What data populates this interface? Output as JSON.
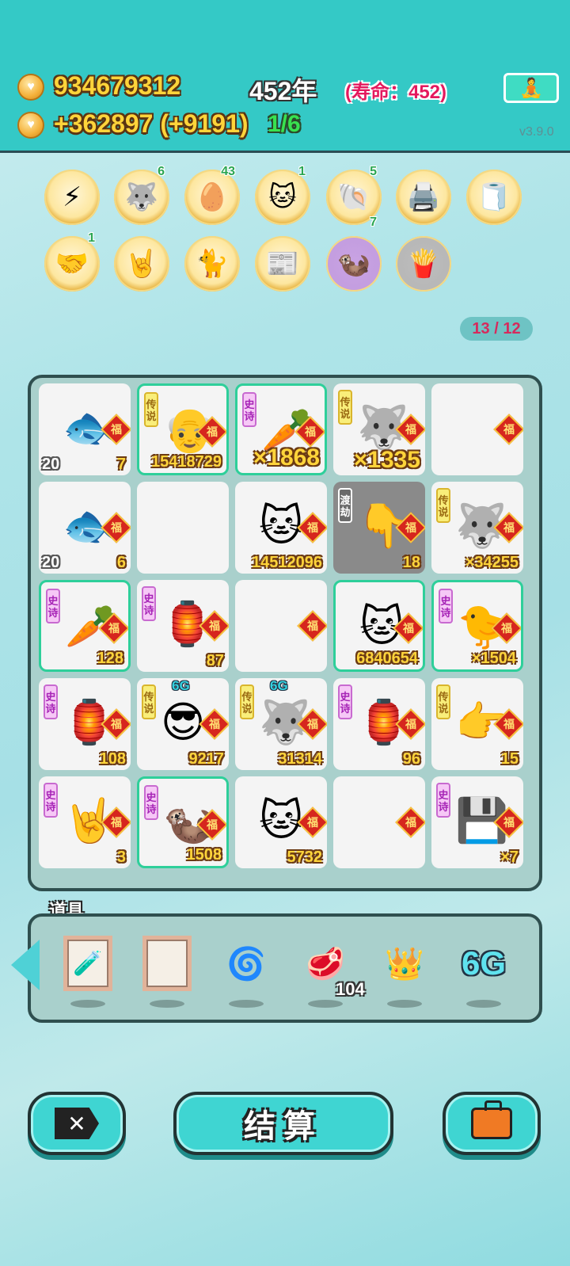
{
  "header": {
    "coins": "934679312",
    "income": "+362897 (+9191)",
    "year": "452年",
    "lifespan": "(寿命：452)",
    "fraction": "1/6",
    "version": "v3.9.0",
    "meditate_icon": "meditation-icon"
  },
  "buffs": [
    {
      "icon": "⚡",
      "name": "lightning-icon",
      "badge": ""
    },
    {
      "icon": "🐺",
      "name": "husky-icon",
      "badge": "6"
    },
    {
      "icon": "🥚",
      "name": "egg-tray-icon",
      "badge": "43"
    },
    {
      "icon": "🐱",
      "name": "cat-icon",
      "badge": "1"
    },
    {
      "icon": "🐚",
      "name": "shell-icon",
      "badge": "5",
      "badge2": "7"
    },
    {
      "icon": "🖨️",
      "name": "printer-icon",
      "badge": ""
    },
    {
      "icon": "🧻",
      "name": "tissue-box-icon",
      "badge": ""
    },
    {
      "icon": "🤝",
      "name": "handshake-icon",
      "badge": "1"
    },
    {
      "icon": "🤘",
      "name": "rock-hand-icon",
      "badge": ""
    },
    {
      "icon": "🐈",
      "name": "cats-icon",
      "badge": ""
    },
    {
      "icon": "📰",
      "name": "time-magazine-icon",
      "badge": ""
    },
    {
      "icon": "🦦",
      "name": "otters-icon",
      "badge": ""
    },
    {
      "icon": "🍟",
      "name": "fries-icon",
      "badge": ""
    }
  ],
  "progress_pill": "13 / 12",
  "fu_text": "福",
  "tags": {
    "legend": "传说",
    "epic": "史诗",
    "tribulation": "渡劫"
  },
  "grid": [
    [
      {
        "icon": "🐟",
        "left": "20",
        "right": "7"
      },
      {
        "icon": "👴",
        "tag": "legend",
        "right": "15418729",
        "green": true
      },
      {
        "icon": "🥕",
        "tag": "epic",
        "right": "×1868",
        "big": true,
        "green": true
      },
      {
        "icon": "🐺",
        "tag": "legend",
        "right": "×1335",
        "big": true
      },
      {
        "icon": "",
        "right": ""
      }
    ],
    [
      {
        "icon": "🐟",
        "left": "20",
        "right": "6"
      },
      {
        "icon": "",
        "nofu": true
      },
      {
        "icon": "🐱",
        "right": "14512096"
      },
      {
        "icon": "👇",
        "tag": "tribulation",
        "right": "18",
        "dark": true
      },
      {
        "icon": "🐺",
        "tag": "legend",
        "right": "×34255"
      }
    ],
    [
      {
        "icon": "🥕",
        "tag": "epic",
        "right": "128",
        "green": true
      },
      {
        "icon": "🏮",
        "tag": "epic",
        "right": "87"
      },
      {
        "icon": "",
        "right": ""
      },
      {
        "icon": "🐱",
        "right": "6840654",
        "green": true
      },
      {
        "icon": "🐤",
        "tag": "epic",
        "right": "×1504",
        "green": true
      }
    ],
    [
      {
        "icon": "🏮",
        "tag": "epic",
        "right": "108"
      },
      {
        "icon": "😎",
        "tag": "legend",
        "right": "9217",
        "g6": "6G"
      },
      {
        "icon": "🐺",
        "tag": "legend",
        "right": "31314",
        "g6": "6G"
      },
      {
        "icon": "🏮",
        "tag": "epic",
        "right": "96"
      },
      {
        "icon": "👉",
        "tag": "legend",
        "right": "15"
      }
    ],
    [
      {
        "icon": "🤘",
        "tag": "epic",
        "right": "3"
      },
      {
        "icon": "🦦",
        "tag": "epic",
        "right": "1508",
        "green": true
      },
      {
        "icon": "🐱",
        "right": "5732"
      },
      {
        "icon": "",
        "right": ""
      },
      {
        "icon": "💾",
        "tag": "epic",
        "right": "×7"
      }
    ]
  ],
  "items": {
    "label": "道具",
    "list": [
      {
        "icon": "🧪",
        "name": "potion-frame-icon"
      },
      {
        "icon": "",
        "name": "empty-frame-icon"
      },
      {
        "icon": "🌀",
        "name": "black-hole-icon"
      },
      {
        "icon": "🥩",
        "name": "liver-icon",
        "count": "104"
      },
      {
        "icon": "👑",
        "name": "crown-icon"
      },
      {
        "icon": "6G",
        "name": "6g-icon"
      }
    ]
  },
  "buttons": {
    "settle": "结算",
    "close_glyph": "✕"
  }
}
